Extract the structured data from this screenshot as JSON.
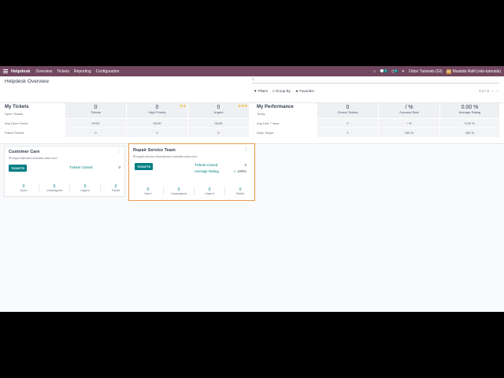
{
  "navbar": {
    "brand": "Helpdesk",
    "menu": [
      "Overview",
      "Tickets",
      "Reporting",
      "Configuration"
    ],
    "chat_badge": "5",
    "activity_badge": "8",
    "company": "Odoo Tutorials (GI)",
    "avatar_initials": "MR",
    "user": "Mustafa Rafil (odo-tutorials)"
  },
  "control_panel": {
    "title": "Helpdesk Overview",
    "search_placeholder": "",
    "filters": "Filters",
    "group_by": "Group By",
    "favorites": "Favorites",
    "pager": "1-2 / 2"
  },
  "my_tickets": {
    "title": "My Tickets",
    "row_labels": [
      "Open Tickets",
      "Avg Open Hours",
      "Failed Tickets"
    ],
    "columns": [
      {
        "value": "0",
        "label": "Tickets",
        "avg": "00:00",
        "failed": "0"
      },
      {
        "value": "0",
        "label": "High Priority",
        "avg": "00:00",
        "failed": "0",
        "stars": "★★"
      },
      {
        "value": "0",
        "label": "Urgent",
        "avg": "00:00",
        "failed": "0",
        "stars": "★★★"
      }
    ]
  },
  "my_performance": {
    "title": "My Performance",
    "row_labels": [
      "Today",
      "Avg Last 7 days",
      "Daily Target"
    ],
    "columns": [
      {
        "value": "0",
        "label": "Closed Tickets",
        "avg": "0",
        "target": "1"
      },
      {
        "value": "/ %",
        "label": "Success Rate",
        "avg": "/ %",
        "target": "100 %"
      },
      {
        "value": "0.00 %",
        "label": "Average Rating",
        "avg": "0.00 %",
        "target": "100 %"
      }
    ]
  },
  "teams": [
    {
      "name": "Customer Care",
      "email": "support@odoo-tutorials.odoo.com",
      "button": "TICKETS",
      "closed_label": "Tickets Closed",
      "closed_value": "0",
      "stats": [
        {
          "n": "0",
          "t": "Open"
        },
        {
          "n": "0",
          "t": "Unassigned"
        },
        {
          "n": "0",
          "t": "Urgent"
        },
        {
          "n": "0",
          "t": "Failed"
        }
      ]
    },
    {
      "name": "Repair Service Team",
      "email": "repair-service-team@odoo-tutorials.odoo.com",
      "button": "TICKETS",
      "closed_label": "Tickets Closed",
      "closed_value": "2",
      "rating_label": "Average Rating",
      "rating_value": "100%",
      "stats": [
        {
          "n": "0",
          "t": "Open"
        },
        {
          "n": "0",
          "t": "Unassigned"
        },
        {
          "n": "0",
          "t": "Urgent"
        },
        {
          "n": "0",
          "t": "Failed"
        }
      ]
    }
  ],
  "colors": {
    "navbar": "#71485f",
    "accent": "#017e84",
    "selected_border": "#ee9a4d",
    "stars": "#f3b31a"
  }
}
